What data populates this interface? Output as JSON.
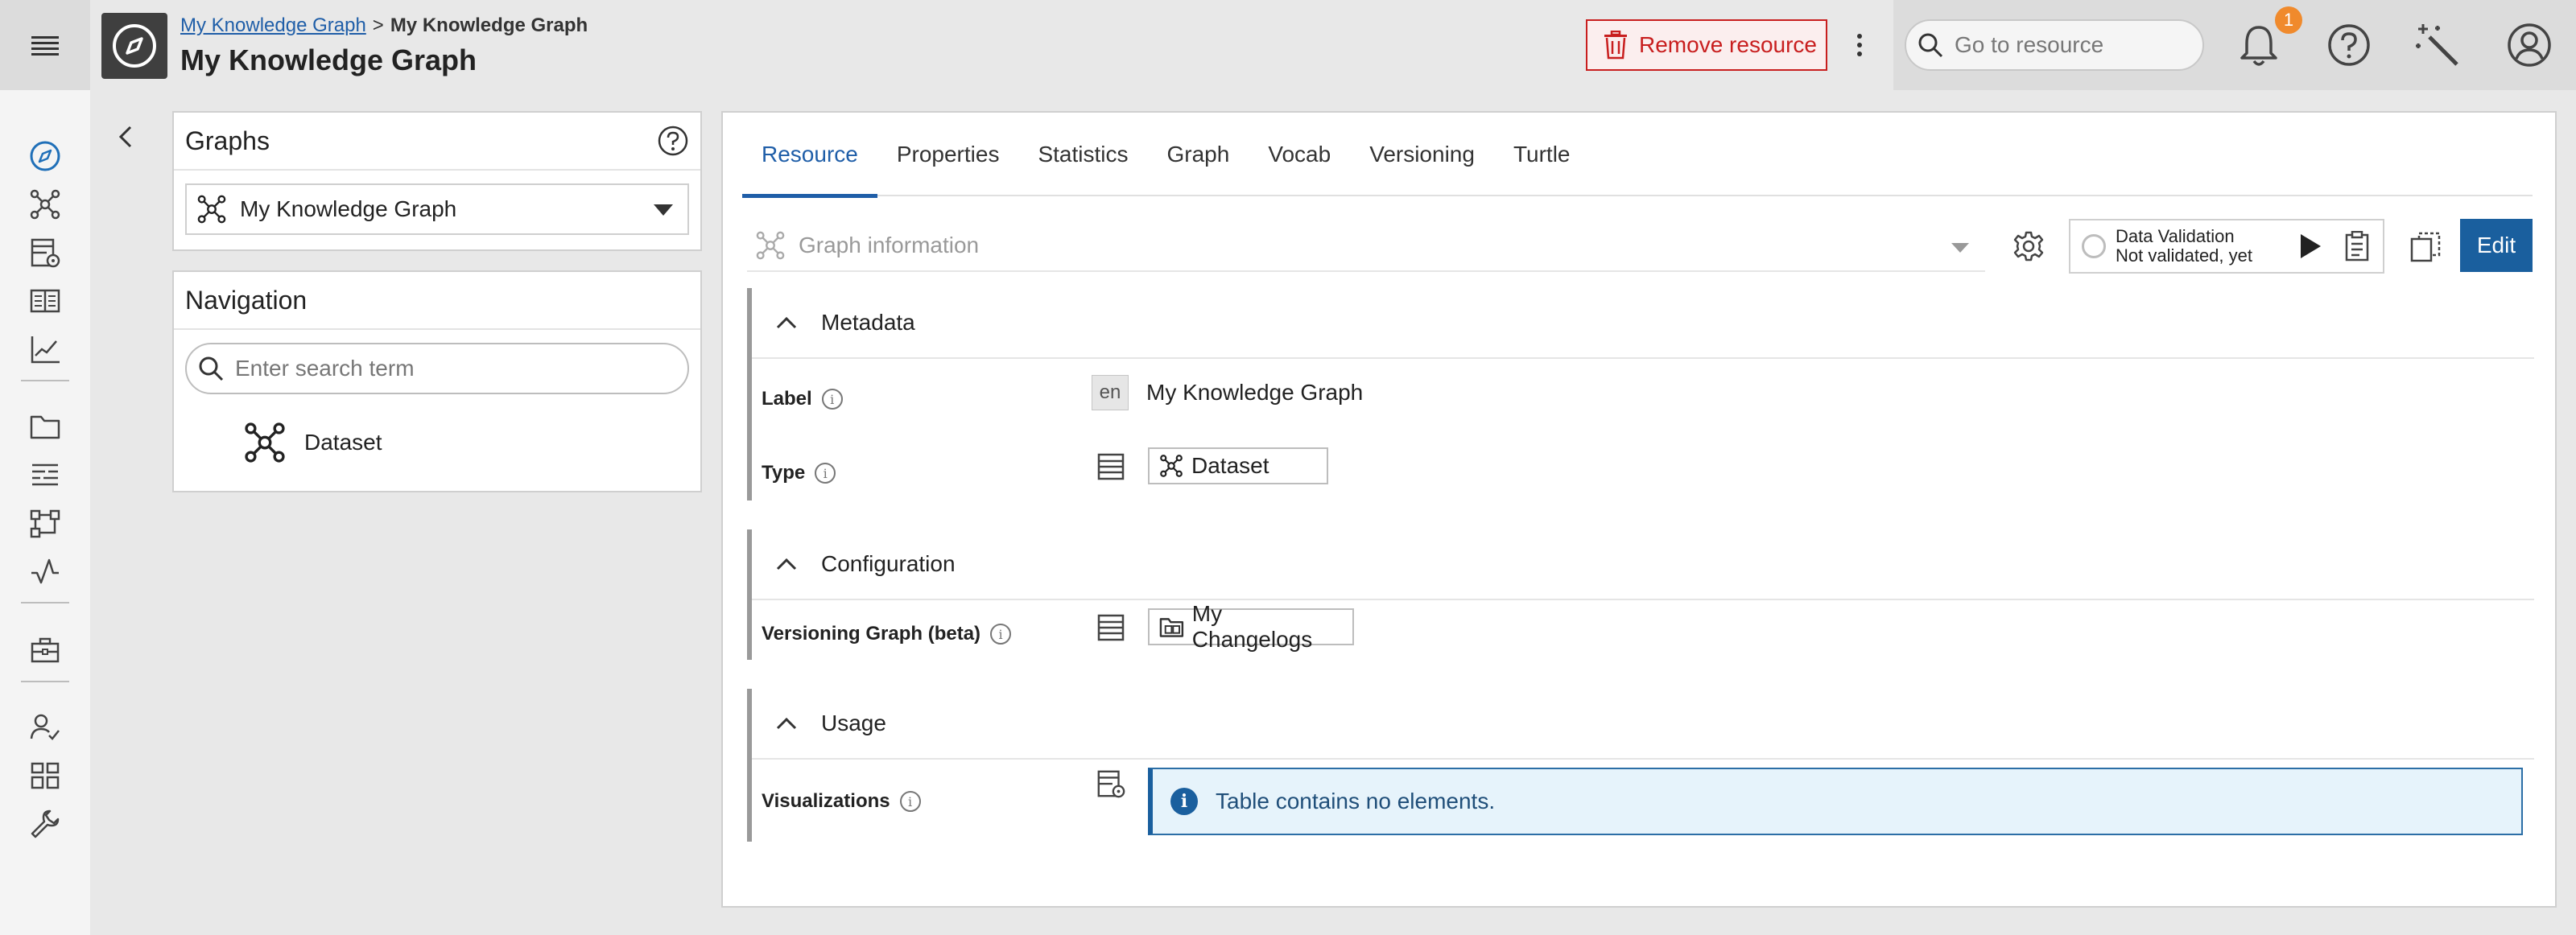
{
  "header": {
    "breadcrumb": {
      "link": "My Knowledge Graph",
      "separator": ">",
      "current": "My Knowledge Graph"
    },
    "title": "My Knowledge Graph",
    "remove_button": "Remove resource",
    "search_placeholder": "Go to resource",
    "notification_count": "1"
  },
  "graphs_panel": {
    "title": "Graphs",
    "selected_graph": "My Knowledge Graph"
  },
  "navigation_panel": {
    "title": "Navigation",
    "search_placeholder": "Enter search term",
    "items": [
      {
        "label": "Dataset"
      }
    ]
  },
  "tabs": [
    {
      "label": "Resource",
      "active": true
    },
    {
      "label": "Properties"
    },
    {
      "label": "Statistics"
    },
    {
      "label": "Graph"
    },
    {
      "label": "Vocab"
    },
    {
      "label": "Versioning"
    },
    {
      "label": "Turtle"
    }
  ],
  "toolbar": {
    "view_placeholder": "Graph information",
    "validation_title": "Data Validation",
    "validation_status": "Not validated, yet",
    "edit_label": "Edit"
  },
  "sections": {
    "metadata": {
      "title": "Metadata",
      "label_field": {
        "name": "Label",
        "lang": "en",
        "value": "My Knowledge Graph"
      },
      "type_field": {
        "name": "Type",
        "value": "Dataset"
      }
    },
    "configuration": {
      "title": "Configuration",
      "versioning_field": {
        "name": "Versioning Graph (beta)",
        "value": "My Changelogs"
      }
    },
    "usage": {
      "title": "Usage",
      "visualizations_field": {
        "name": "Visualizations",
        "message": "Table contains no elements."
      }
    }
  },
  "colors": {
    "accent": "#1a5f9e",
    "danger": "#c81e1e",
    "badge": "#f08a2c",
    "info_background": "#e6f3fb"
  }
}
